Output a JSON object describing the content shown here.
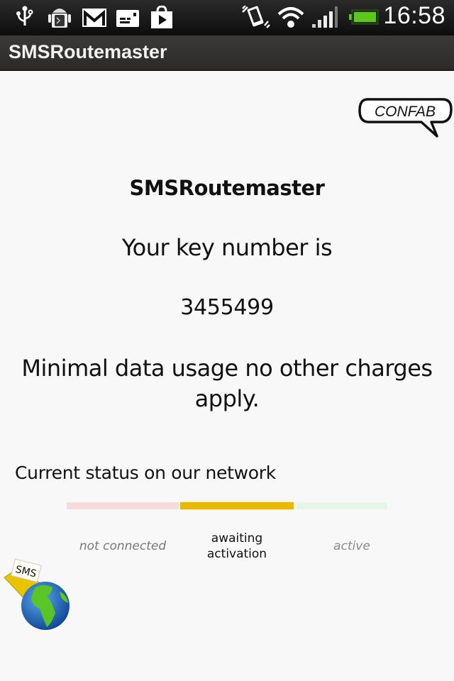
{
  "status_bar": {
    "icons": [
      "usb-icon",
      "android-debug-icon",
      "gmail-icon",
      "sim-card-icon",
      "play-store-icon",
      "vibrate-icon",
      "wifi-icon",
      "signal-icon",
      "battery-icon"
    ],
    "time": "16:58",
    "battery_color": "#5cc81e"
  },
  "title_bar": {
    "title": "SMSRoutemaster"
  },
  "badge": {
    "label": "CONFAB"
  },
  "main": {
    "app_title": "SMSRoutemaster",
    "key_label": "Your key number is",
    "key_number": "3455499",
    "info_text": "Minimal data usage no other charges apply."
  },
  "network_status": {
    "heading": "Current status on our network",
    "current_stage": "awaiting activation",
    "stages": [
      {
        "label": "not connected",
        "color": "#f5dcdc",
        "active": false
      },
      {
        "label": "awaiting activation",
        "color": "#e9b800",
        "active": true
      },
      {
        "label": "active",
        "color": "#e6f6e6",
        "active": false
      }
    ]
  },
  "logo": {
    "envelope_label": "SMS"
  }
}
